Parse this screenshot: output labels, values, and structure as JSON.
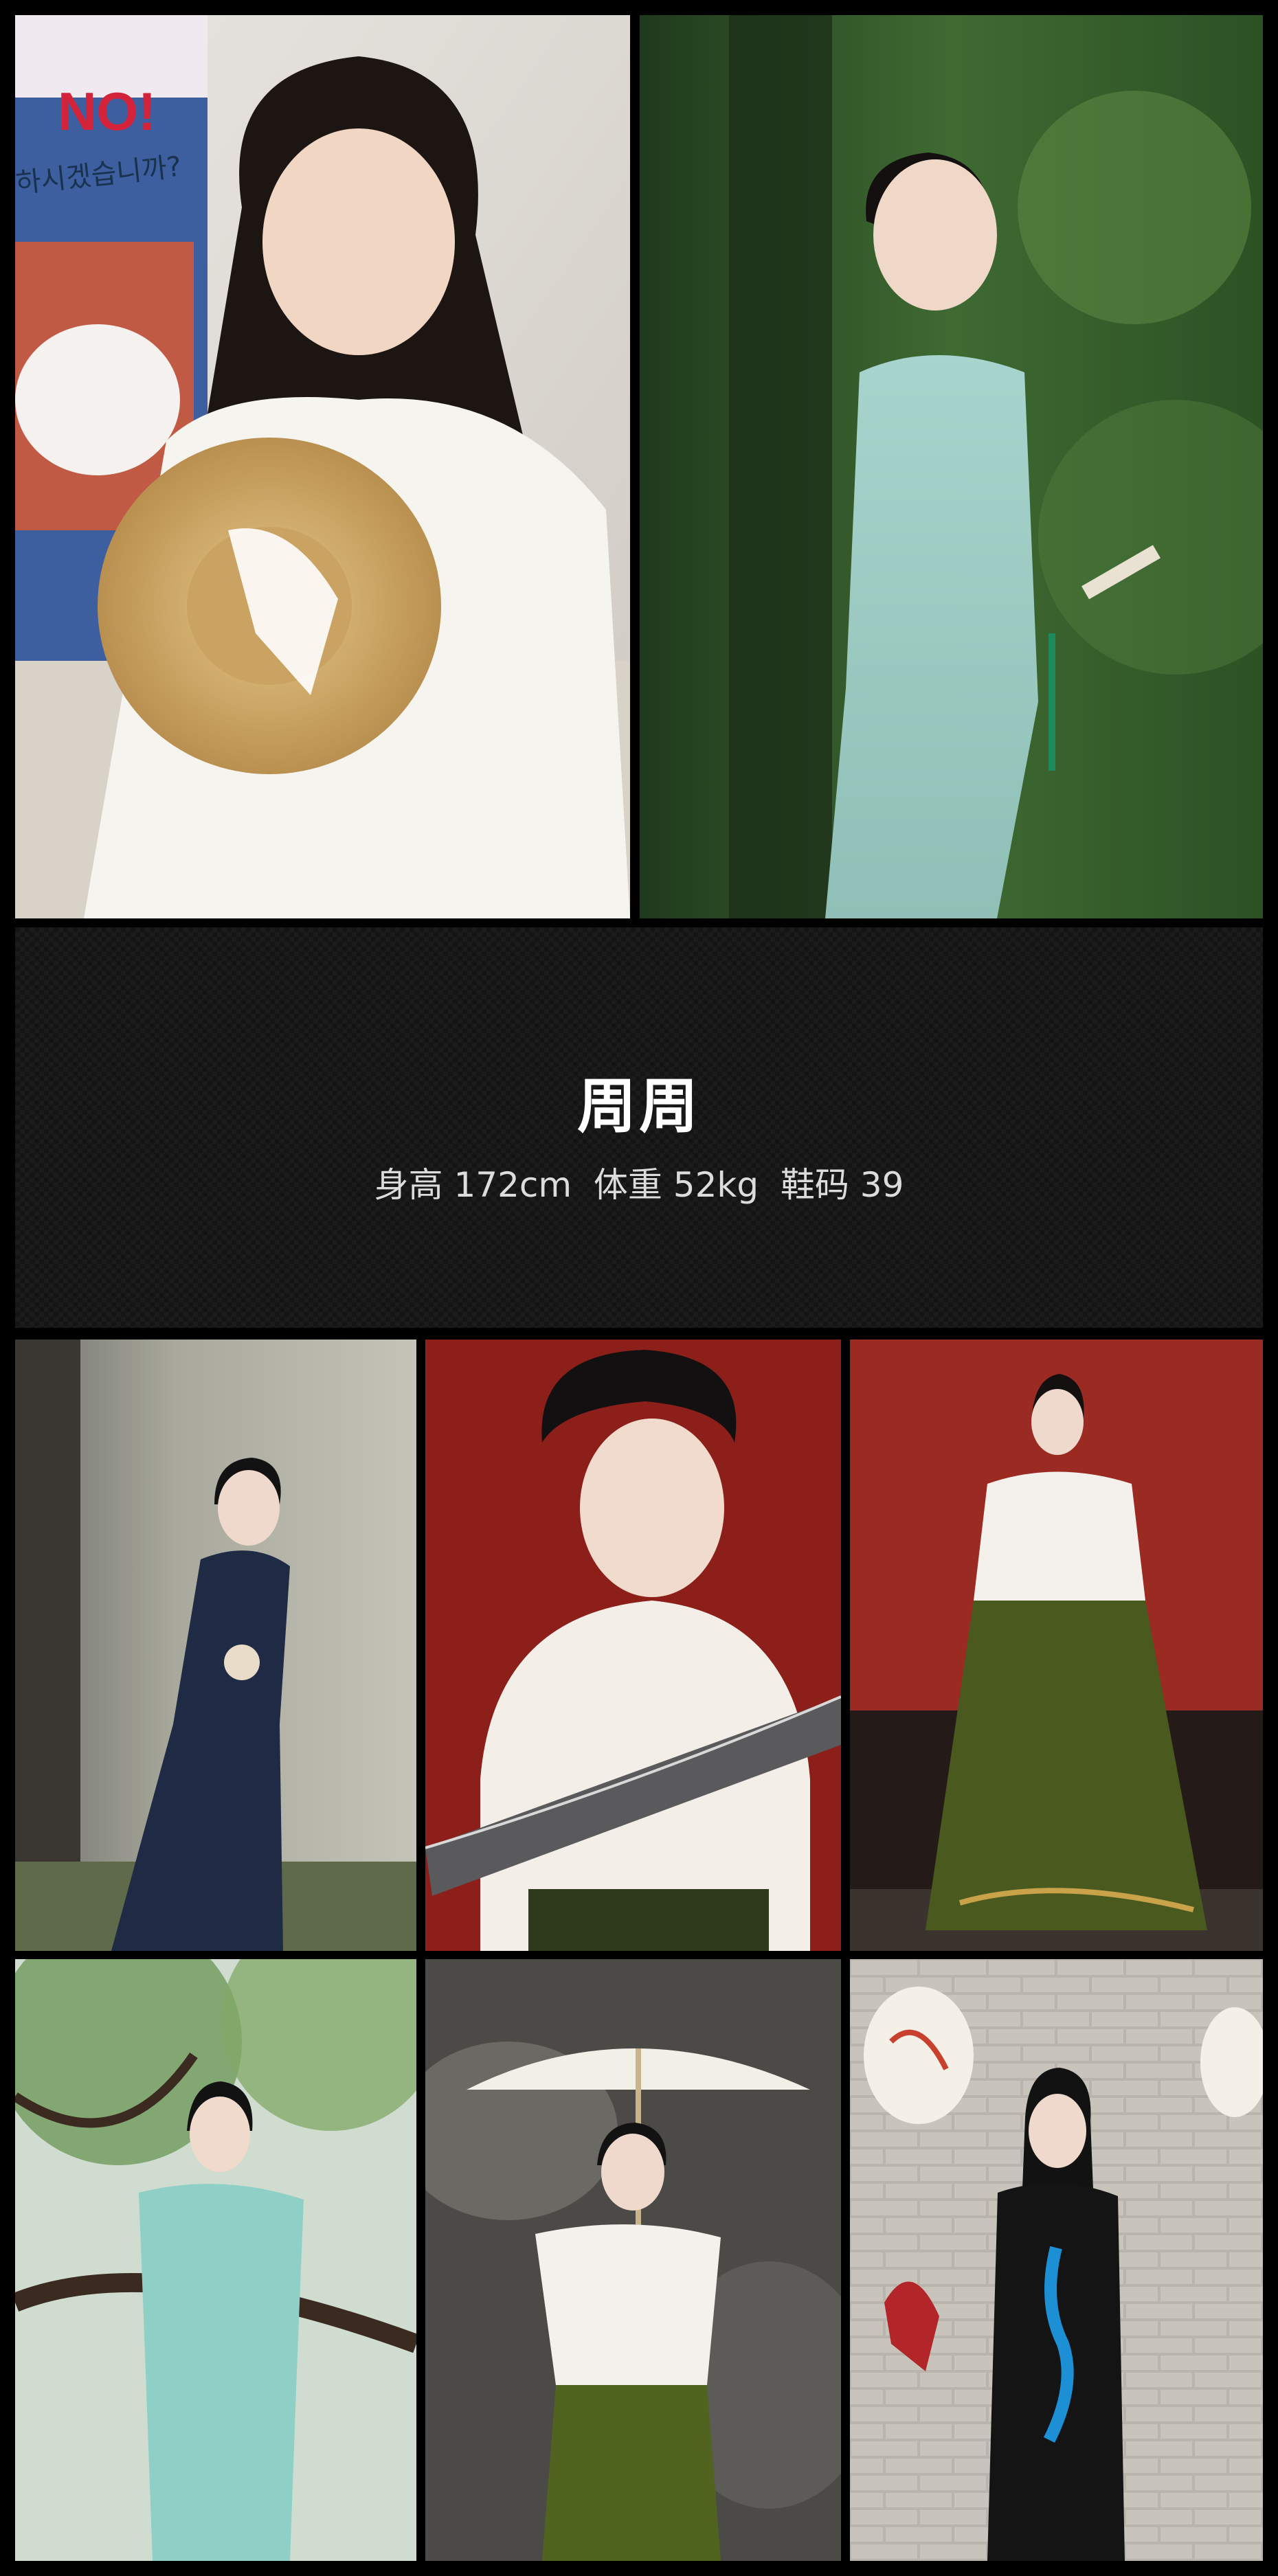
{
  "profile": {
    "name": "周周",
    "stats": "身高 172cm  体重 52kg  鞋码 39"
  },
  "poster_text": {
    "line1": "NO!",
    "line2": "하시겠습니까?"
  },
  "photos": [
    {
      "icon": "portrait-white-shirt-straw-hat"
    },
    {
      "icon": "portrait-mint-qipao-forest"
    },
    {
      "icon": "portrait-navy-qipao-wall"
    },
    {
      "icon": "portrait-fan-red-wall"
    },
    {
      "icon": "portrait-green-skirt-red-wall"
    },
    {
      "icon": "portrait-mint-qipao-tree"
    },
    {
      "icon": "portrait-parasol-rock"
    },
    {
      "icon": "portrait-black-dress-brick-wall"
    }
  ],
  "colors": {
    "background": "#000000",
    "info_band": "#141414",
    "text": "#ffffff"
  }
}
